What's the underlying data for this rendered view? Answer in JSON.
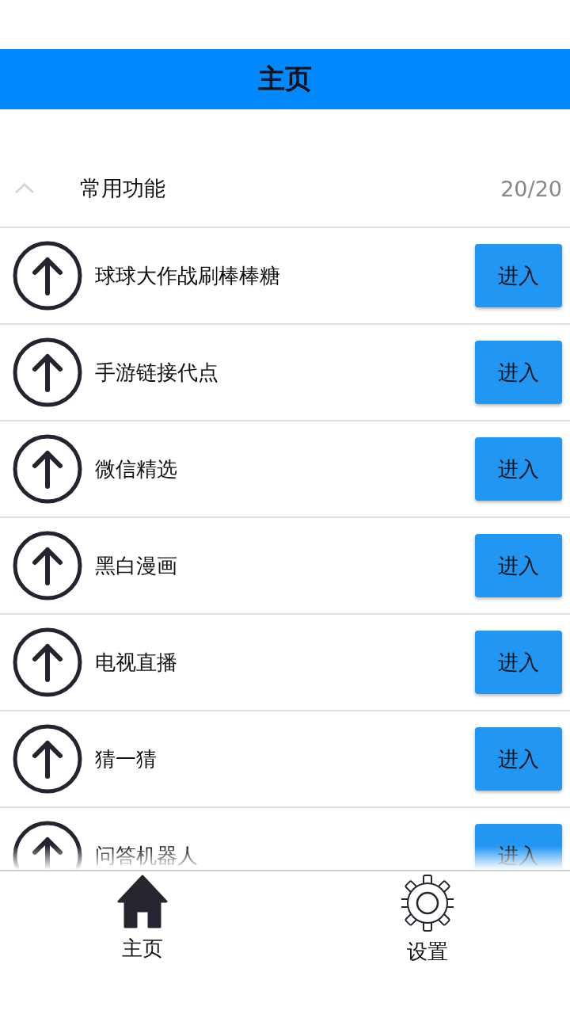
{
  "header": {
    "title": "主页"
  },
  "section": {
    "title": "常用功能",
    "count": "20/20",
    "expanded": true
  },
  "items": [
    {
      "label": "球球大作战刷棒棒糖",
      "button": "进入"
    },
    {
      "label": "手游链接代点",
      "button": "进入"
    },
    {
      "label": "微信精选",
      "button": "进入"
    },
    {
      "label": "黑白漫画",
      "button": "进入"
    },
    {
      "label": "电视直播",
      "button": "进入"
    },
    {
      "label": "猜一猜",
      "button": "进入"
    },
    {
      "label": "问答机器人",
      "button": "进入"
    }
  ],
  "bottom_nav": [
    {
      "label": "主页",
      "kind": "home"
    },
    {
      "label": "设置",
      "kind": "settings"
    }
  ]
}
